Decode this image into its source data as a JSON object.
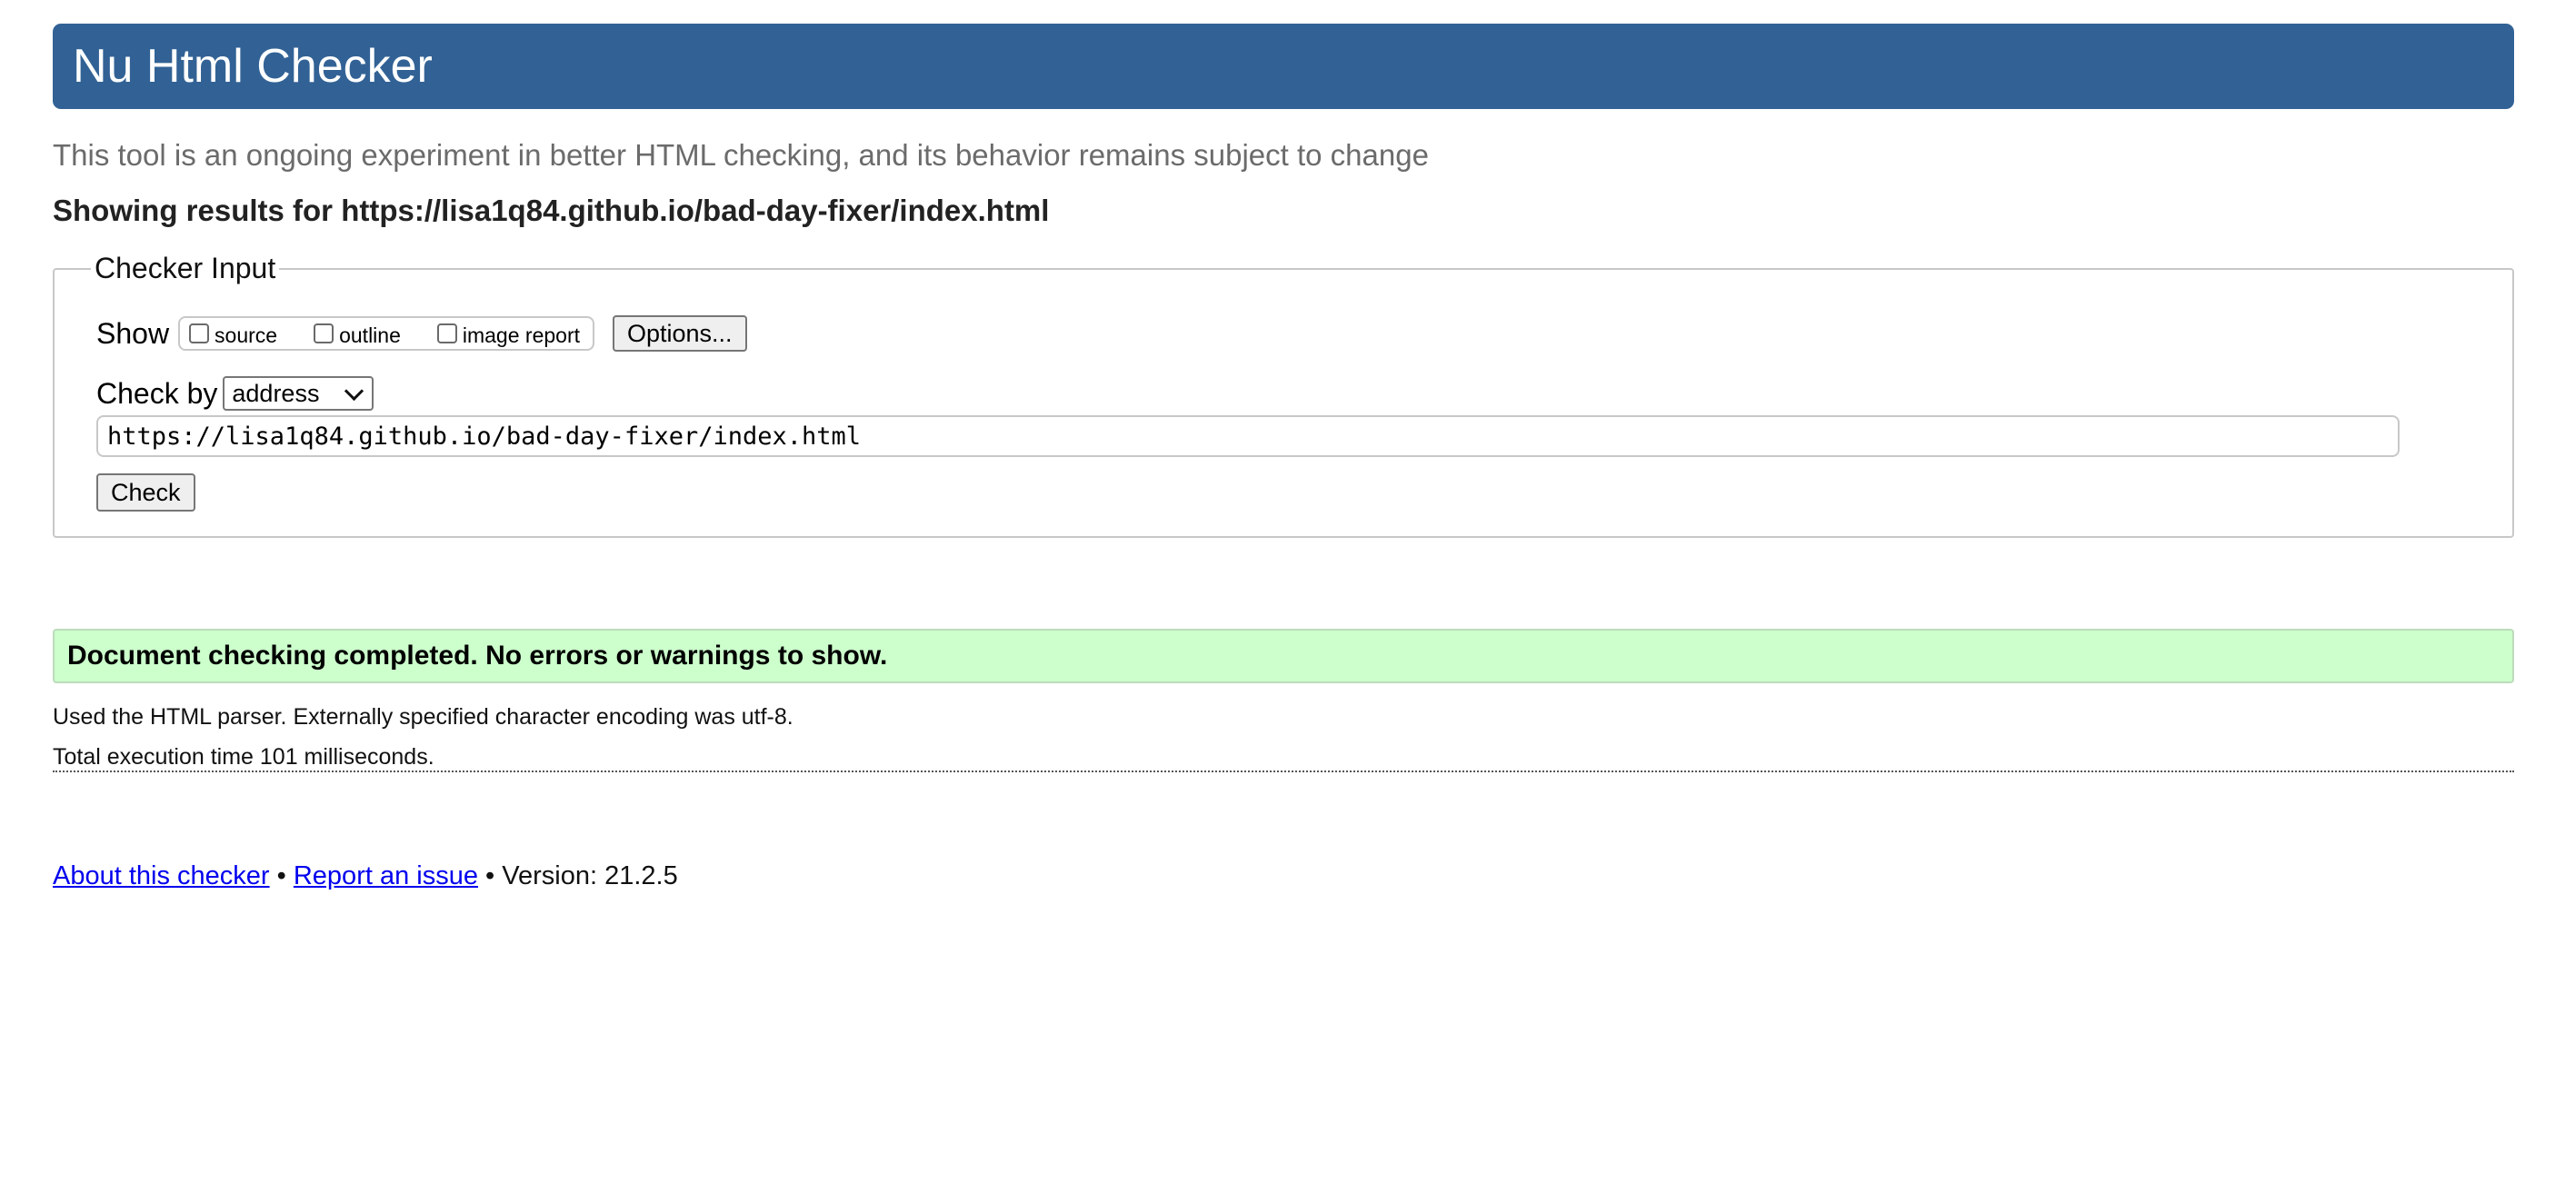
{
  "header": {
    "title": "Nu Html Checker",
    "tagline": "This tool is an ongoing experiment in better HTML checking, and its behavior remains subject to change",
    "showing_results": "Showing results for https://lisa1q84.github.io/bad-day-fixer/index.html",
    "banner_color": "#326295"
  },
  "checker_input": {
    "legend": "Checker Input",
    "show_label": "Show",
    "show_options": [
      {
        "label": "source",
        "checked": false
      },
      {
        "label": "outline",
        "checked": false
      },
      {
        "label": "image report",
        "checked": false
      }
    ],
    "options_button": "Options...",
    "check_by_label": "Check by",
    "check_by_selected": "address",
    "url_value": "https://lisa1q84.github.io/bad-day-fixer/index.html",
    "check_button": "Check"
  },
  "result": {
    "status_message": "Document checking completed. No errors or warnings to show.",
    "status_color": "#ccffcc",
    "parser_info": "Used the HTML parser. Externally specified character encoding was utf-8.",
    "execution_time": "Total execution time 101 milliseconds."
  },
  "footer": {
    "about_link": "About this checker",
    "separator": "•",
    "report_link": "Report an issue",
    "version": "Version: 21.2.5"
  }
}
